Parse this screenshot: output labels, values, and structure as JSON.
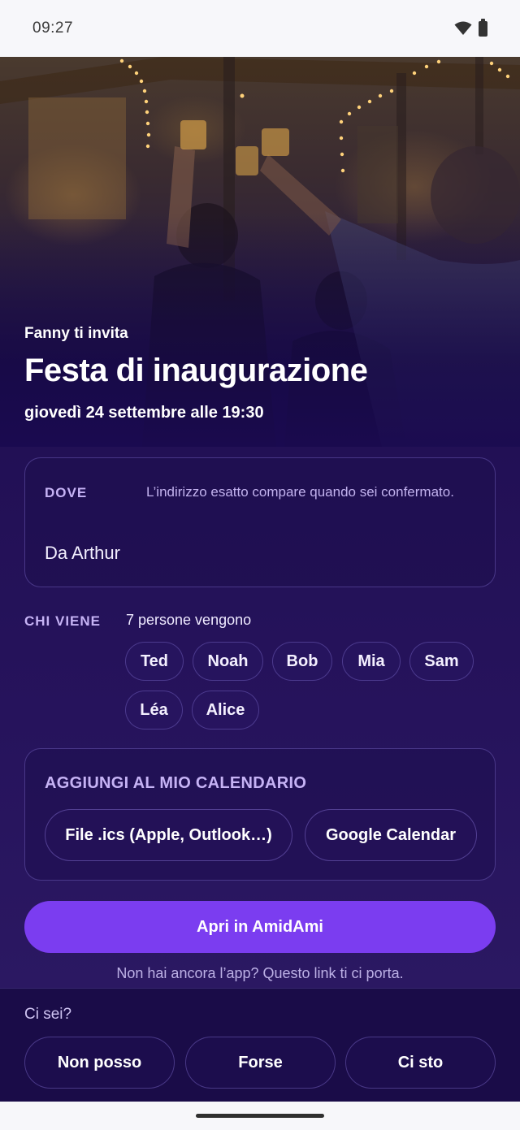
{
  "status_bar": {
    "time": "09:27",
    "wifi_icon": "wifi-icon",
    "battery_icon": "battery-icon"
  },
  "hero": {
    "host_line": "Fanny ti invita",
    "title": "Festa di inaugurazione",
    "date": "giovedì 24 settembre alle 19:30"
  },
  "where": {
    "label": "DOVE",
    "note": "L’indirizzo esatto compare quando sei confermato.",
    "place": "Da Arthur"
  },
  "who": {
    "label": "CHI VIENE",
    "count_text": "7 persone vengono",
    "attendees": [
      "Ted",
      "Noah",
      "Bob",
      "Mia",
      "Sam",
      "Léa",
      "Alice"
    ]
  },
  "calendar": {
    "label": "AGGIUNGI AL MIO CALENDARIO",
    "ics_button": "File .ics (Apple, Outlook…)",
    "google_button": "Google Calendar"
  },
  "open_app": {
    "button": "Apri in AmidAmi",
    "note": "Non hai ancora l’app? Questo link ti ci porta."
  },
  "rsvp": {
    "question": "Ci sei?",
    "options": [
      "Non posso",
      "Forse",
      "Ci sto"
    ]
  },
  "colors": {
    "accent": "#7b3df0",
    "background": "#221055",
    "label": "#c6b3f5"
  }
}
